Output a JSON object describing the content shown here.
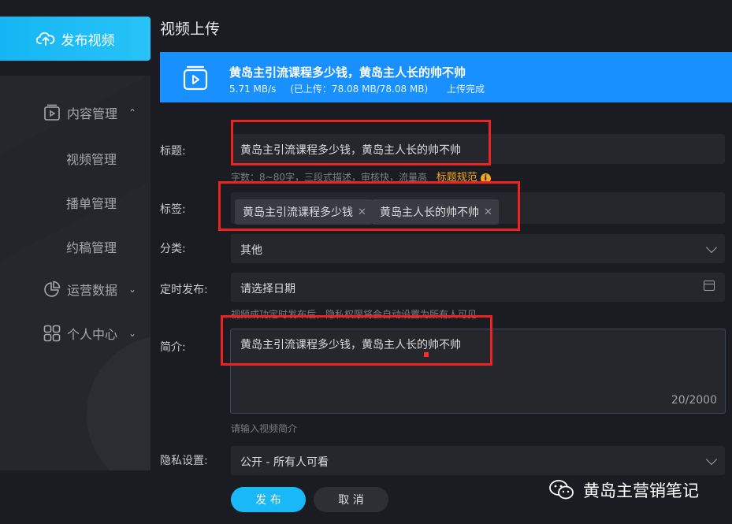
{
  "sidebar": {
    "publish_label": "发布视频",
    "menu": [
      {
        "label": "内容管理",
        "icon": "play-square-icon",
        "expanded": true
      },
      {
        "label": "运营数据",
        "icon": "pie-chart-icon",
        "expanded": false
      },
      {
        "label": "个人中心",
        "icon": "grid-apps-icon",
        "expanded": false
      }
    ],
    "content_sub": [
      "视频管理",
      "播单管理",
      "约稿管理"
    ]
  },
  "page": {
    "title": "视频上传"
  },
  "upload": {
    "file_name": "黄岛主引流课程多少钱，黄岛主人长的帅不帅",
    "speed": "5.71 MB/s",
    "uploaded": "(已上传：78.08 MB/78.08 MB)",
    "status": "上传完成",
    "progress": 1.0
  },
  "form": {
    "title_label": "标题:",
    "title_value": "黄岛主引流课程多少钱，黄岛主人长的帅不帅",
    "title_hint": "字数：8~80字，三段式描述，审核快，流量高",
    "title_rules_link": "标题规范",
    "tags_label": "标签:",
    "tags": [
      "黄岛主引流课程多少钱",
      "黄岛主人长的帅不帅"
    ],
    "category_label": "分类:",
    "category_value": "其他",
    "schedule_label": "定时发布:",
    "schedule_placeholder": "请选择日期",
    "schedule_hint": "视频成功定时发布后，隐私权限将会自动设置为所有人可见",
    "desc_label": "简介:",
    "desc_value": "黄岛主引流课程多少钱，黄岛主人长的帅不帅",
    "desc_count": "20/2000",
    "desc_hint": "请输入视频简介",
    "privacy_label": "隐私设置:",
    "privacy_value": "公开 - 所有人可看"
  },
  "actions": {
    "publish": "发 布",
    "cancel": "取 消"
  },
  "watermark": "黄岛主营销笔记",
  "colors": {
    "accent": "#18b9f6",
    "upload_bar": "#1890ff",
    "highlight": "#ee2222"
  }
}
